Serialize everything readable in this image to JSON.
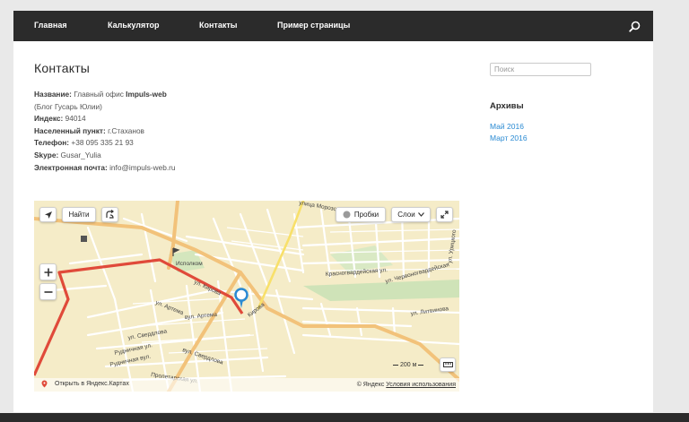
{
  "nav": {
    "items": [
      "Главная",
      "Калькулятор",
      "Контакты",
      "Пример страницы"
    ]
  },
  "main": {
    "title": "Контакты",
    "info": {
      "name_label": "Название:",
      "name_value": "Главный офис",
      "name_brand": "Impuls-web",
      "name_note": "(Блог Гусарь Юлии)",
      "index_label": "Индекс:",
      "index_value": "94014",
      "city_label": "Населенный пункт:",
      "city_value": "г.Стаханов",
      "phone_label": "Телефон:",
      "phone_value": "+38 095 335 21 93",
      "skype_label": "Skype:",
      "skype_value": "Gusar_Yulia",
      "email_label": "Электронная почта:",
      "email_value": "info@impuls-web.ru"
    }
  },
  "sidebar": {
    "search_placeholder": "Поиск",
    "archives_title": "Архивы",
    "archives": [
      "Май 2016",
      "Март 2016"
    ]
  },
  "map": {
    "find_label": "Найти",
    "traffic_label": "Пробки",
    "layers_label": "Слои",
    "scale_label": "200 м",
    "open_in_yandex": "Открыть в Яндекс.Картах",
    "copyright": "© Яндекс",
    "terms": "Условия использования",
    "streets": {
      "krovy": "Кирова",
      "artema": "ул. Артема",
      "artema2": "вул. Артема",
      "sverdlova": "ул. Свердлова",
      "sverdlova2": "вул. Свердлова",
      "rudnichnaya": "Рудничная ул.",
      "rudnichnaya2": "Рудничная вул.",
      "proletarskaya": "Пролетарская ул.",
      "krasnogv": "Красногвардейская ул.",
      "chervonogv": "ул. Червоногвардейская",
      "litvinova": "ул. Литвинова",
      "uritskogo": "ул. Урицкого",
      "morozova": "улица Морозова",
      "ispolkom": "Исполком",
      "kirova_left": "ул. Кирова"
    }
  },
  "colors": {
    "nav_bg": "#2b2b2b",
    "link": "#2a8ad3",
    "route": "#e04a3a",
    "map_bg": "#f5ecc8"
  }
}
